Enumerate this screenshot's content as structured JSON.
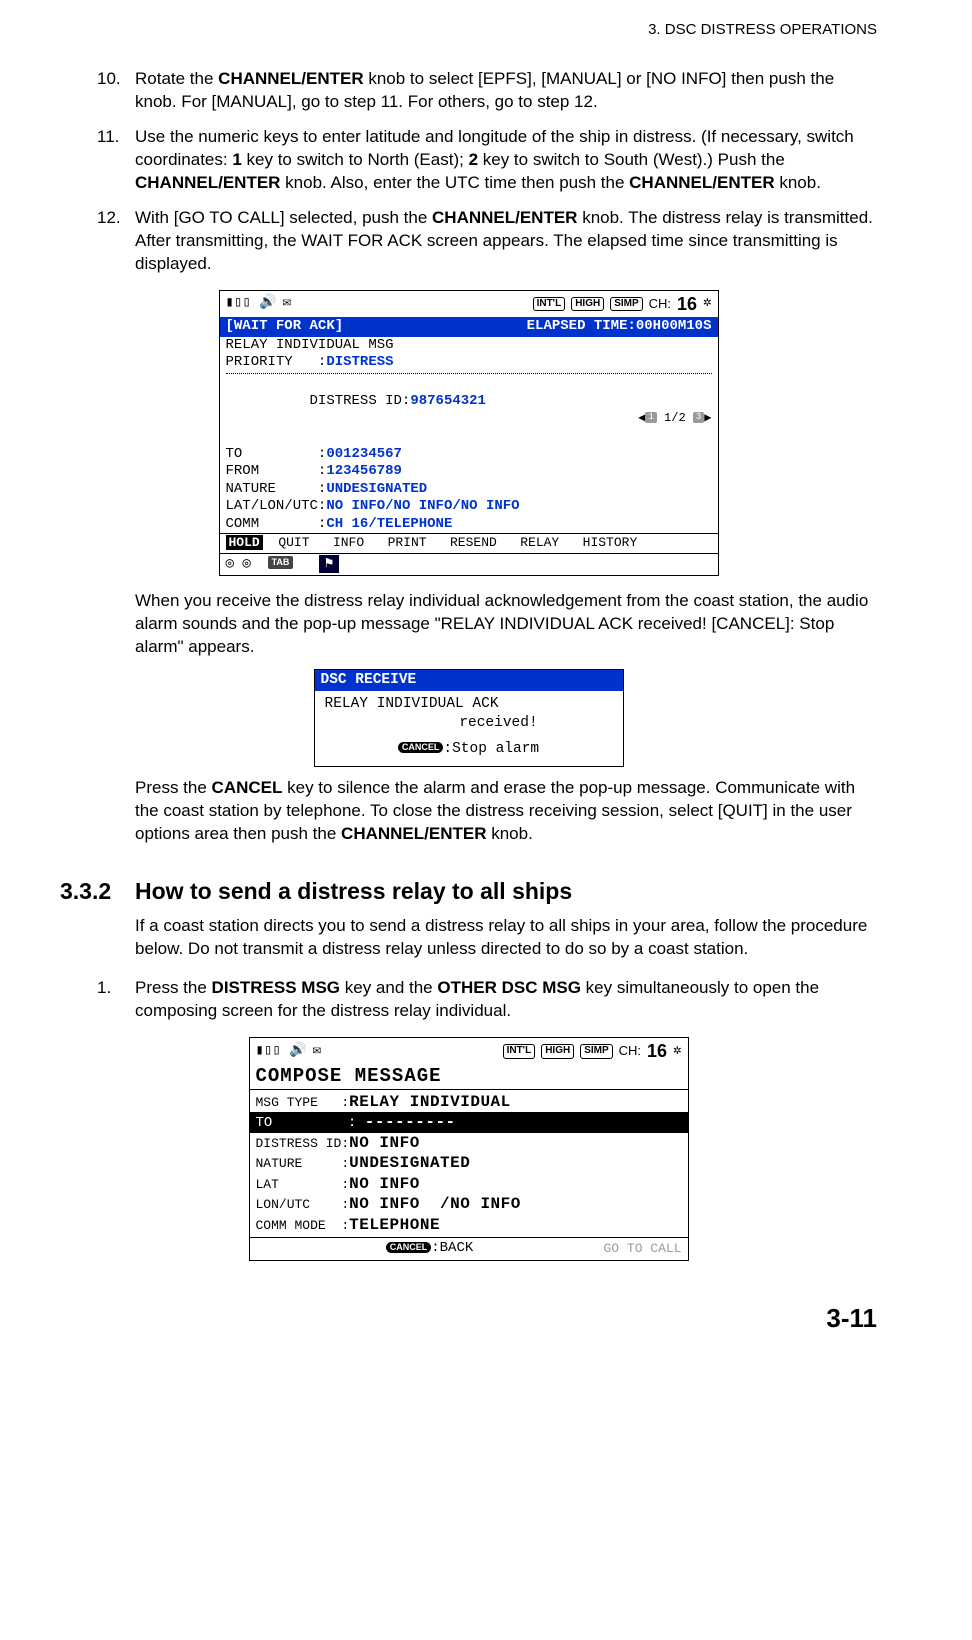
{
  "running_head": "3.  DSC DISTRESS OPERATIONS",
  "steps_a": [
    {
      "num": "10.",
      "t1": "Rotate the ",
      "b1": "CHANNEL/ENTER",
      "t2": " knob to select [EPFS], [MANUAL] or [NO INFO] then push the knob. For [MANUAL], go to step 11. For others, go to step 12."
    },
    {
      "num": "11.",
      "t1": "Use the numeric keys to enter latitude and longitude of the ship in distress. (If necessary, switch coordinates: ",
      "b1": "1",
      "t2": " key to switch to North (East); ",
      "b2": "2",
      "t3": " key to switch to South (West).) Push the ",
      "b3": "CHANNEL/ENTER",
      "t4": " knob. Also, enter the UTC time then push the ",
      "b4": "CHANNEL/ENTER",
      "t5": " knob."
    },
    {
      "num": "12.",
      "t1": "With [GO TO CALL] selected, push the ",
      "b1": "CHANNEL/ENTER",
      "t2": " knob. The distress relay is transmitted. After transmitting, the WAIT FOR ACK screen appears. The elapsed time since transmitting is displayed."
    }
  ],
  "fig1": {
    "pills": [
      "INT'L",
      "HIGH",
      "SIMP"
    ],
    "ch_lbl": "CH:",
    "ch_val": "16",
    "band_left": "[WAIT FOR ACK]",
    "band_right": "ELAPSED TIME:00H00M10S",
    "rows": [
      {
        "lbl": "RELAY INDIVIDUAL MSG",
        "val": ""
      },
      {
        "lbl": "PRIORITY   :",
        "val": "DISTRESS"
      }
    ],
    "rows2": [
      {
        "lbl": "DISTRESS ID:",
        "val": "987654321",
        "page": true
      },
      {
        "lbl": "TO         :",
        "val": "001234567"
      },
      {
        "lbl": "FROM       :",
        "val": "123456789"
      },
      {
        "lbl": "NATURE     :",
        "val": "UNDESIGNATED"
      },
      {
        "lbl": "LAT/LON/UTC:",
        "val": "NO INFO/NO INFO/NO INFO"
      },
      {
        "lbl": "COMM       :",
        "val": "CH 16/TELEPHONE"
      }
    ],
    "page_ind": "1/2",
    "menu": [
      "HOLD",
      "QUIT",
      "INFO",
      "PRINT",
      "RESEND",
      "RELAY",
      "HISTORY"
    ],
    "tab": "TAB"
  },
  "para1": "When you receive the distress relay individual acknowledgement from the coast station, the audio alarm sounds and the pop-up message \"RELAY INDIVIDUAL ACK received! [CANCEL]: Stop alarm\" appears.",
  "popup": {
    "title": "DSC RECEIVE",
    "line1": "RELAY INDIVIDUAL ACK",
    "line2": "received!",
    "cancel_badge": "CANCEL",
    "stop": ":Stop alarm"
  },
  "para2_a": "Press the ",
  "para2_b": "CANCEL",
  "para2_c": " key to silence the alarm and erase the pop-up message. Communicate with the coast station by telephone. To close the distress receiving session, select [QUIT] in the user options area then push the ",
  "para2_d": "CHANNEL/ENTER",
  "para2_e": " knob.",
  "section": {
    "num": "3.3.2",
    "title": "How to send a distress relay to all ships",
    "intro": "If a coast station directs you to send a distress relay to all ships in your area, follow the procedure below. Do not transmit a distress relay unless directed to do so by a coast station."
  },
  "steps_b": [
    {
      "num": "1.",
      "t1": "Press the ",
      "b1": "DISTRESS MSG",
      "t2": " key and the ",
      "b2": "OTHER DSC MSG",
      "t3": " key simultaneously to open the composing screen for the distress relay individual."
    }
  ],
  "fig2": {
    "pills": [
      "INT'L",
      "HIGH",
      "SIMP"
    ],
    "ch_lbl": "CH:",
    "ch_val": "16",
    "title": "COMPOSE MESSAGE",
    "rows": [
      {
        "lbl": "MSG TYPE   :",
        "val": "RELAY INDIVIDUAL",
        "sel": false
      },
      {
        "lbl": "TO         :",
        "val": "---------",
        "sel": true
      },
      {
        "lbl": "DISTRESS ID:",
        "val": "NO INFO",
        "sel": false
      },
      {
        "lbl": "NATURE     :",
        "val": "UNDESIGNATED",
        "sel": false
      },
      {
        "lbl": "LAT        :",
        "val": "NO INFO",
        "sel": false
      },
      {
        "lbl": "LON/UTC    :",
        "val": "NO INFO  /NO INFO",
        "sel": false
      },
      {
        "lbl": "COMM MODE  :",
        "val": "TELEPHONE",
        "sel": false
      }
    ],
    "cancel_badge": "CANCEL",
    "back": ":BACK",
    "goto": "GO TO CALL"
  },
  "page_num": "3-11"
}
